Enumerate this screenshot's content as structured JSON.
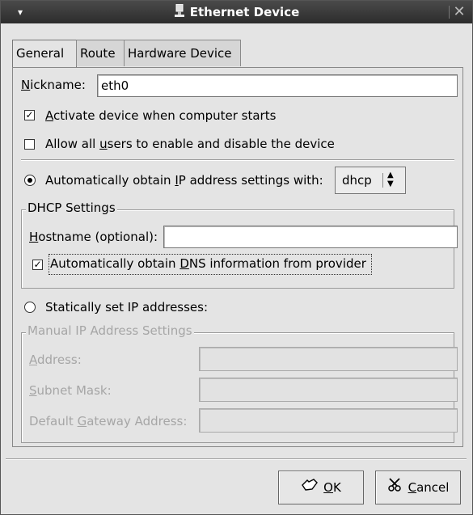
{
  "window": {
    "title": "Ethernet Device",
    "menu_glyph": "▾",
    "close_glyph": "✕"
  },
  "tabs": [
    {
      "label": "General",
      "active": true
    },
    {
      "label": "Route",
      "active": false
    },
    {
      "label": "Hardware Device",
      "active": false
    }
  ],
  "general": {
    "nickname_label_accel": "N",
    "nickname_label_rest": "ickname:",
    "nickname_value": "eth0",
    "activate_check": {
      "checked": true,
      "accel": "A",
      "rest": "ctivate device when computer starts"
    },
    "allow_users_check": {
      "checked": false,
      "pre": "Allow all ",
      "accel": "u",
      "rest": "sers to enable and disable the device"
    },
    "auto_radio": {
      "selected": true,
      "pre": "Automatically obtain ",
      "accel": "I",
      "rest": "P address settings with:"
    },
    "protocol_value": "dhcp",
    "dhcp_frame_title": "DHCP Settings",
    "hostname_label_accel": "H",
    "hostname_label_rest": "ostname (optional):",
    "hostname_value": "",
    "dns_check": {
      "checked": true,
      "pre": "Automatically obtain ",
      "accel": "D",
      "rest": "NS information from provider"
    },
    "static_radio": {
      "selected": false,
      "label": "Statically set IP addresses:"
    },
    "manual_frame_title": "Manual IP Address Settings",
    "address_label_accel": "A",
    "address_label_rest": "ddress:",
    "subnet_label_accel": "S",
    "subnet_label_rest": "ubnet Mask:",
    "gateway_label_pre": "Default ",
    "gateway_label_accel": "G",
    "gateway_label_rest": "ateway Address:",
    "address_value": "",
    "subnet_value": "",
    "gateway_value": ""
  },
  "buttons": {
    "ok_accel": "O",
    "ok_rest": "K",
    "cancel_accel": "C",
    "cancel_rest": "ancel"
  }
}
